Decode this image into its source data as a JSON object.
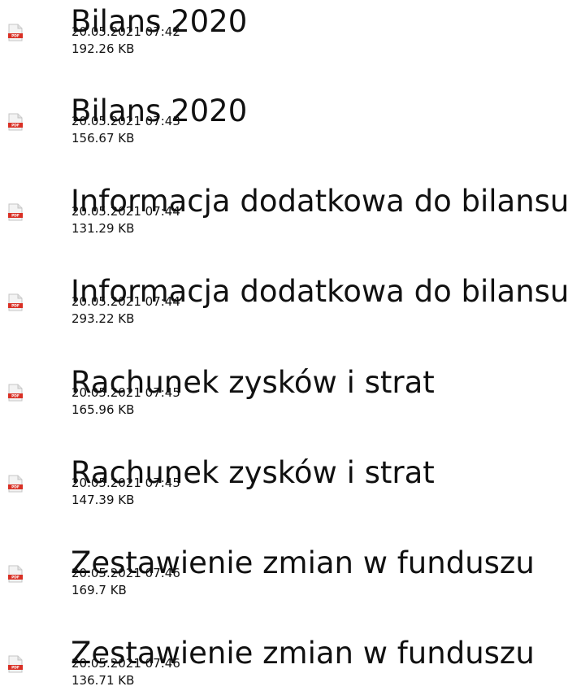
{
  "colors": {
    "text": "#111111",
    "pdf_red": "#d93025"
  },
  "icon": {
    "name": "pdf-icon",
    "label": "PDF"
  },
  "files": [
    {
      "name": "Bilans 2020",
      "date": "20.05.2021 07:42",
      "size": "192.26 KB"
    },
    {
      "name": "Bilans 2020",
      "date": "20.05.2021 07:43",
      "size": "156.67 KB"
    },
    {
      "name": "Informacja dodatkowa do bilansu",
      "date": "20.05.2021 07:44",
      "size": "131.29 KB"
    },
    {
      "name": "Informacja dodatkowa do bilansu",
      "date": "20.05.2021 07:44",
      "size": "293.22 KB"
    },
    {
      "name": "Rachunek zysków i strat",
      "date": "20.05.2021 07:45",
      "size": "165.96 KB"
    },
    {
      "name": "Rachunek zysków i strat",
      "date": "20.05.2021 07:45",
      "size": "147.39 KB"
    },
    {
      "name": "Zestawienie zmian w funduszu",
      "date": "20.05.2021 07:46",
      "size": "169.7 KB"
    },
    {
      "name": "Zestawienie zmian w funduszu",
      "date": "20.05.2021 07:46",
      "size": "136.71 KB"
    }
  ]
}
